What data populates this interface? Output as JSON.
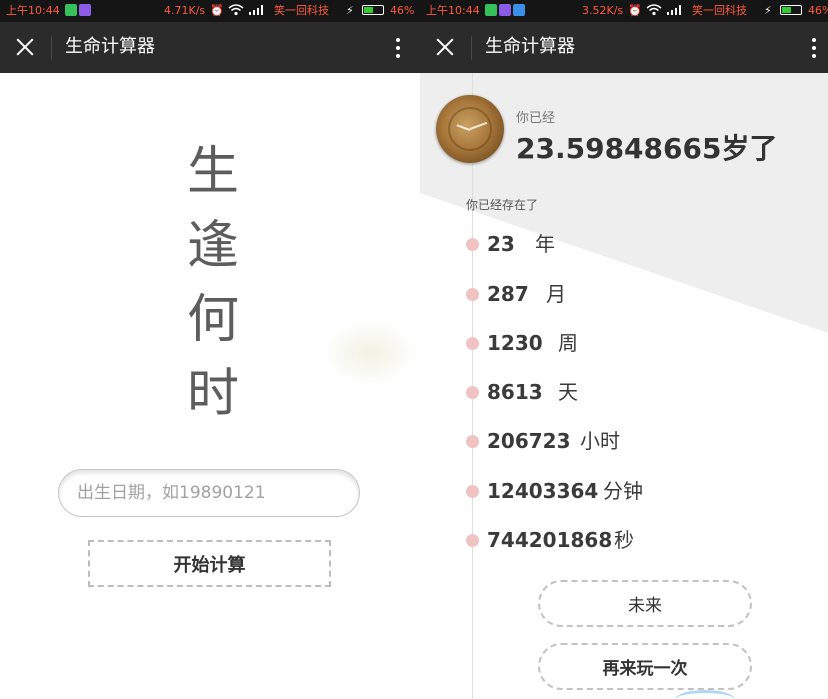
{
  "status_left": {
    "time": "上午10:44",
    "speed": "4.71K/s",
    "carrier": "笑一回科技",
    "battery": "46%",
    "colors": {
      "highlight": "#ff5a3c",
      "battery_fill": "#33cc33",
      "app1": "#36c05a",
      "app2": "#8c5ce8"
    }
  },
  "status_right": {
    "time": "上午10:44",
    "speed": "3.52K/s",
    "carrier": "笑一回科技",
    "battery": "46%",
    "colors": {
      "app3": "#3a8fe8"
    }
  },
  "titlebar": {
    "title": "生命计算器",
    "icons": [
      "close-icon",
      "more-vertical-icon"
    ],
    "background": "#2b2b2b"
  },
  "left": {
    "slogan": [
      "生",
      "逢",
      "何",
      "时"
    ],
    "birth_input": {
      "placeholder": "出生日期，如19890121",
      "value": ""
    },
    "start_button": "开始计算"
  },
  "right": {
    "intro": "你已经",
    "age": "23.59848665岁了",
    "exists_label": "你已经存在了",
    "stats": [
      {
        "value": "23",
        "unit": "年"
      },
      {
        "value": "287",
        "unit": "月"
      },
      {
        "value": "1230",
        "unit": "周"
      },
      {
        "value": "8613",
        "unit": "天"
      },
      {
        "value": "206723",
        "unit": "小时"
      },
      {
        "value": "12403364",
        "unit": "分钟"
      },
      {
        "value": "744201868",
        "unit": "秒"
      }
    ],
    "future_button": "未来",
    "again_button": "再来玩一次",
    "dot_color": "#f1c2c2",
    "background_tone": "#eeeeee"
  }
}
